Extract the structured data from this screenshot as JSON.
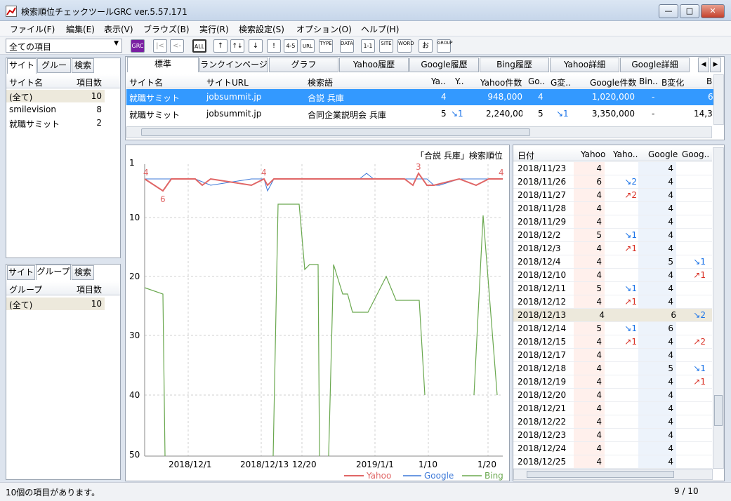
{
  "window": {
    "title": "検索順位チェックツールGRC  ver.5.57.171",
    "min": "—",
    "max": "□",
    "close": "✕"
  },
  "menu": [
    "ファイル(F)",
    "編集(E)",
    "表示(V)",
    "ブラウズ(B)",
    "実行(R)",
    "検索設定(S)",
    "オプション(O)",
    "ヘルプ(H)"
  ],
  "filter": {
    "value": "全ての項目"
  },
  "toolbar": [
    "GRC",
    "|<",
    "<-",
    "ALL",
    "↑",
    "↑↓",
    "↓",
    "!",
    "4-5",
    "URL",
    "TYPE",
    "DATA",
    "1-1",
    "SITE",
    "WORD",
    "お",
    "GROUP"
  ],
  "left_top": {
    "tabs": [
      "サイト",
      "グループ",
      "検索"
    ],
    "headers": [
      "サイト名",
      "項目数"
    ],
    "rows": [
      [
        "(全て)",
        "10"
      ],
      [
        "smilevision",
        "8"
      ],
      [
        "就職サミット",
        "2"
      ]
    ]
  },
  "left_bottom": {
    "tabs": [
      "サイト",
      "グループ",
      "検索"
    ],
    "headers": [
      "グループ",
      "項目数"
    ],
    "rows": [
      [
        "(全て)",
        "10"
      ]
    ]
  },
  "main_tabs": [
    "標準",
    "ランクインページ",
    "グラフ",
    "Yahoo履歴",
    "Google履歴",
    "Bing履歴",
    "Yahoo詳細",
    "Google詳細"
  ],
  "main_grid": {
    "headers": [
      "サイト名",
      "サイトURL",
      "検索語",
      "Ya..",
      "Y..",
      "Yahoo件数",
      "Go..",
      "G変..",
      "Google件数",
      "Bin..",
      "B変化",
      "B"
    ],
    "rows": [
      [
        "就職サミット",
        "jobsummit.jp",
        "合説 兵庫",
        "4",
        "",
        "948,000",
        "4",
        "",
        "1,020,000",
        "-",
        "",
        "6"
      ],
      [
        "就職サミット",
        "jobsummit.jp",
        "合同企業説明会 兵庫",
        "5",
        "↘1",
        "2,240,000",
        "5",
        "↘1",
        "3,350,000",
        "-",
        "",
        "14,3"
      ]
    ]
  },
  "chart_data": {
    "type": "line",
    "title": "「合説 兵庫」検索順位",
    "x_ticks": [
      "2018/12/1",
      "2018/12/13",
      "12/20",
      "2019/1/1",
      "1/10",
      "1/20"
    ],
    "y_ticks": [
      "1",
      "10",
      "20",
      "30",
      "40",
      "50"
    ],
    "ylim": [
      1,
      50
    ],
    "y_inverted": true,
    "series": [
      {
        "name": "Yahoo",
        "color": "#e06666"
      },
      {
        "name": "Google",
        "color": "#3c78d8"
      },
      {
        "name": "Bing",
        "color": "#6aa84f"
      }
    ],
    "annotations": [
      "4",
      "6",
      "4",
      "3",
      "4"
    ],
    "note": "Yahoo and Google rank around 4-6 throughout; Bing ranges 8-50."
  },
  "history": {
    "headers": [
      "日付",
      "Yahoo",
      "Yaho..",
      "Google",
      "Goog.."
    ],
    "rows": [
      [
        "2018/11/23",
        "4",
        "",
        "4",
        ""
      ],
      [
        "2018/11/26",
        "6",
        "↘2",
        "4",
        ""
      ],
      [
        "2018/11/27",
        "4",
        "↗2",
        "4",
        ""
      ],
      [
        "2018/11/28",
        "4",
        "",
        "4",
        ""
      ],
      [
        "2018/11/29",
        "4",
        "",
        "4",
        ""
      ],
      [
        "2018/12/2",
        "5",
        "↘1",
        "4",
        ""
      ],
      [
        "2018/12/3",
        "4",
        "↗1",
        "4",
        ""
      ],
      [
        "2018/12/4",
        "4",
        "",
        "5",
        "↘1"
      ],
      [
        "2018/12/10",
        "4",
        "",
        "4",
        "↗1"
      ],
      [
        "2018/12/11",
        "5",
        "↘1",
        "4",
        ""
      ],
      [
        "2018/12/12",
        "4",
        "↗1",
        "4",
        ""
      ],
      [
        "2018/12/13",
        "4",
        "",
        "6",
        "↘2"
      ],
      [
        "2018/12/14",
        "5",
        "↘1",
        "6",
        ""
      ],
      [
        "2018/12/15",
        "4",
        "↗1",
        "4",
        "↗2"
      ],
      [
        "2018/12/17",
        "4",
        "",
        "4",
        ""
      ],
      [
        "2018/12/18",
        "4",
        "",
        "5",
        "↘1"
      ],
      [
        "2018/12/19",
        "4",
        "",
        "4",
        "↗1"
      ],
      [
        "2018/12/20",
        "4",
        "",
        "4",
        ""
      ],
      [
        "2018/12/21",
        "4",
        "",
        "4",
        ""
      ],
      [
        "2018/12/22",
        "4",
        "",
        "4",
        ""
      ],
      [
        "2018/12/23",
        "4",
        "",
        "4",
        ""
      ],
      [
        "2018/12/24",
        "4",
        "",
        "4",
        ""
      ],
      [
        "2018/12/25",
        "4",
        "",
        "4",
        ""
      ]
    ]
  },
  "status": {
    "left": "10個の項目があります。",
    "right": "9 / 10"
  }
}
